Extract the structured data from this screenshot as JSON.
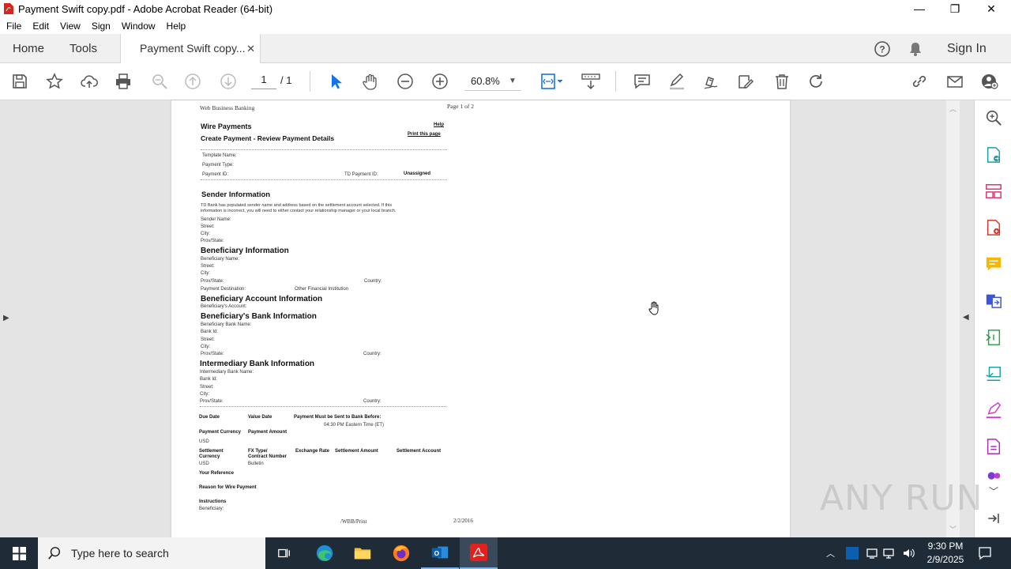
{
  "window": {
    "title": "Payment Swift copy.pdf - Adobe Acrobat Reader (64-bit)",
    "minimize": "—",
    "maximize": "❐",
    "close": "✕"
  },
  "menu": [
    "File",
    "Edit",
    "View",
    "Sign",
    "Window",
    "Help"
  ],
  "tabs": {
    "home": "Home",
    "tools": "Tools",
    "document": "Payment Swift copy...",
    "sign_in": "Sign In"
  },
  "toolbar": {
    "page_current": "1",
    "page_total": "/ 1",
    "zoom": "60.8%"
  },
  "pdf": {
    "header_left": "Web Business Banking",
    "header_right": "Page 1 of 2",
    "wire_payments": "Wire Payments",
    "help_link": "Help",
    "create_payment": "Create Payment - Review Payment Details",
    "print_link": "Print this page",
    "template_name": "Template Name:",
    "payment_type": "Payment Type:",
    "payment_id": "Payment ID:",
    "td_payment_id": "TD Payment ID:",
    "unassigned": "Unassigned",
    "sender_info": "Sender Information",
    "sender_note_1": "TD Bank has populated sender name and address based on the settlement account selected. If this",
    "sender_note_2": "information is incorrect, you will need to either contact your relationship manager or your local branch.",
    "sender_name": "Sender Name:",
    "street": "Street:",
    "city": "City:",
    "prov_state": "Prov/State:",
    "beneficiary_info": "Beneficiary Information",
    "beneficiary_name": "Beneficiary Name:",
    "country": "Country:",
    "payment_destination": "Payment Destination:",
    "other_fi": "Other Financial Institution",
    "beneficiary_account_info": "Beneficiary Account Information",
    "beneficiary_account": "Beneficiary's Account:",
    "beneficiary_bank_info": "Beneficiary's Bank Information",
    "beneficiary_bank_name": "Beneficiary Bank Name:",
    "bank_id": "Bank Id:",
    "intermediary_info": "Intermediary Bank Information",
    "intermediary_bank_name": "Intermediary Bank Name:",
    "due_date": "Due Date",
    "value_date": "Value Date",
    "payment_before": "Payment Must be Sent to Bank Before:",
    "payment_time": "04:30 PM Eastern Time (ET)",
    "payment_currency": "Payment Currency",
    "payment_amount": "Payment Amount",
    "usd": "USD",
    "settlement_currency_1": "Settlement",
    "settlement_currency_2": "Currency",
    "fx_type_1": "FX Type/",
    "fx_type_2": "Contract Number",
    "exchange_rate": "Exchange Rate",
    "settlement_amount": "Settlement Amount",
    "settlement_account": "Settlement Account",
    "bulletin": "Bulletin",
    "your_reference": "Your Reference",
    "reason": "Reason for Wire Payment",
    "instructions": "Instructions",
    "beneficiary": "Beneficiary:",
    "footer_left": "/WBB/Print",
    "footer_right": "2/2/2016"
  },
  "taskbar": {
    "search_placeholder": "Type here to search",
    "time": "9:30 PM",
    "date": "2/9/2025"
  },
  "watermark": "ANY RUN",
  "colors": {
    "acrobat_red": "#d9261c",
    "taskbar": "#1f2b36",
    "viewer_bg": "#e4e4e4",
    "select_blue": "#1473e6"
  }
}
